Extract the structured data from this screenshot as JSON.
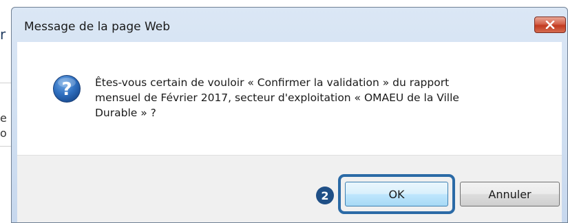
{
  "background_page": {
    "fragment_1": "r",
    "fragment_2": "e",
    "fragment_3": "o"
  },
  "dialog": {
    "title": "Message de la page Web",
    "close_icon": "close-icon",
    "question_icon": "question-icon",
    "message_lines": [
      "Êtes-vous certain de vouloir « Confirmer la validation » du rapport",
      "mensuel de Février 2017, secteur d'exploitation « OMAEU de la Ville",
      "Durable » ?"
    ],
    "ok_label": "OK",
    "cancel_label": "Annuler"
  },
  "annotation": {
    "step_number": "2",
    "highlight_color": "#2b6aa6",
    "badge_color": "#1f4f86"
  }
}
